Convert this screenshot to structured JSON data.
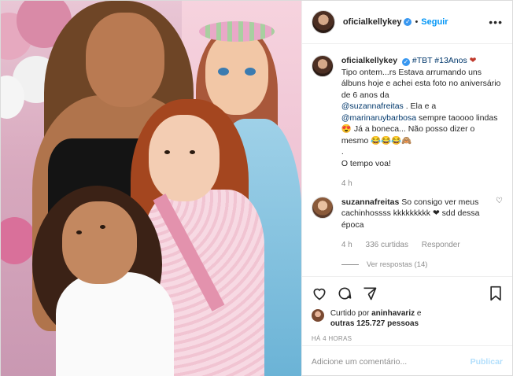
{
  "photo": {
    "alt_icon": "post-photo"
  },
  "header": {
    "username": "oficialkellykey",
    "verified_icon": "verified-badge-icon",
    "separator": "•",
    "follow_label": "Seguir",
    "more_icon": "more-options-icon"
  },
  "caption": {
    "username": "oficialkellykey",
    "tags": "#TBT #13Anos",
    "heart": "❤",
    "text_1": "Tipo ontem...rs Estava arrumando uns álbuns hoje e achei esta foto no aniversário de 6 anos da",
    "mention_1": "@suzannafreitas",
    "text_2": ". Ela e a",
    "mention_2": "@marinaruybarbosa",
    "text_3": "sempre taoooo lindas 😍 Já a boneca... Não posso dizer o mesmo 😂😂😂🙈",
    "text_4": ".",
    "text_5": "O tempo voa!",
    "time": "4 h"
  },
  "comment": {
    "username": "suzannafreitas",
    "text": "So consigo ver meus cachinhossss kkkkkkkkk ❤ sdd dessa época",
    "time": "4 h",
    "likes": "336 curtidas",
    "reply_label": "Responder",
    "view_replies": "Ver respostas (14)"
  },
  "actions": {
    "like_icon": "heart-icon",
    "comment_icon": "comment-icon",
    "share_icon": "share-icon",
    "save_icon": "bookmark-icon"
  },
  "likes": {
    "prefix": "Curtido por",
    "user": "aninhavariz",
    "middle": "e",
    "others": "outras 125.727 pessoas"
  },
  "posted": "HÁ 4 HORAS",
  "add_comment": {
    "placeholder": "Adicione um comentário...",
    "publish_label": "Publicar"
  },
  "colors": {
    "accent": "#0095f6",
    "muted": "#8e8e8e",
    "link": "#00376b",
    "publish_disabled": "#b2dffc"
  }
}
